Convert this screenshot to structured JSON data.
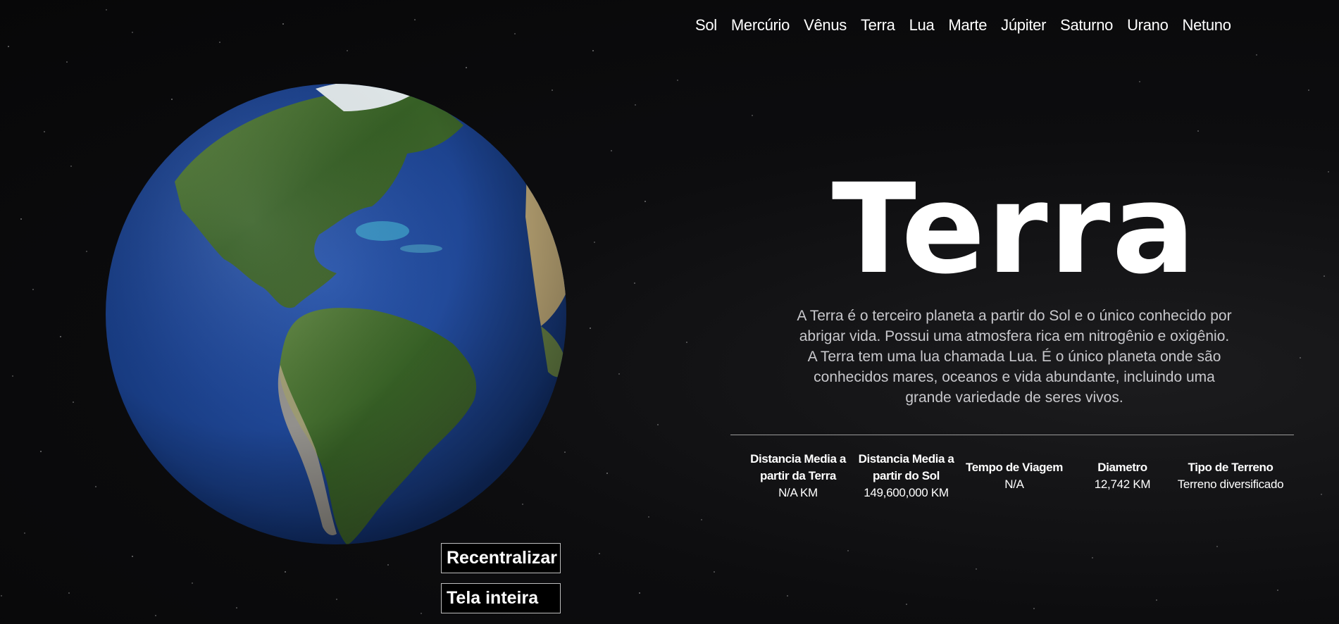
{
  "nav": {
    "items": [
      "Sol",
      "Mercúrio",
      "Vênus",
      "Terra",
      "Lua",
      "Marte",
      "Júpiter",
      "Saturno",
      "Urano",
      "Netuno"
    ]
  },
  "planet": {
    "title": "Terra",
    "description": "A Terra é o terceiro planeta a partir do Sol e o único conhecido por abrigar vida. Possui uma atmosfera rica em nitrogênio e oxigênio. A Terra tem uma lua chamada Lua. É o único planeta onde são conhecidos mares, oceanos e vida abundante, incluindo uma grande variedade de seres vivos."
  },
  "stats": [
    {
      "label": "Distancia Media a partir da Terra",
      "value": "N/A KM"
    },
    {
      "label": "Distancia Media a partir do Sol",
      "value": "149,600,000 KM"
    },
    {
      "label": "Tempo de Viagem",
      "value": "N/A"
    },
    {
      "label": "Diametro",
      "value": "12,742 KM"
    },
    {
      "label": "Tipo de Terreno",
      "value": "Terreno diversificado"
    }
  ],
  "controls": {
    "recenter_label": "Recentralizar",
    "fullscreen_label": "Tela inteira"
  },
  "colors": {
    "background": "#070708",
    "ocean": "#1d3f8a",
    "land": "#3f6b2f",
    "text": "#ffffff",
    "muted_text": "#c8c8cc"
  }
}
